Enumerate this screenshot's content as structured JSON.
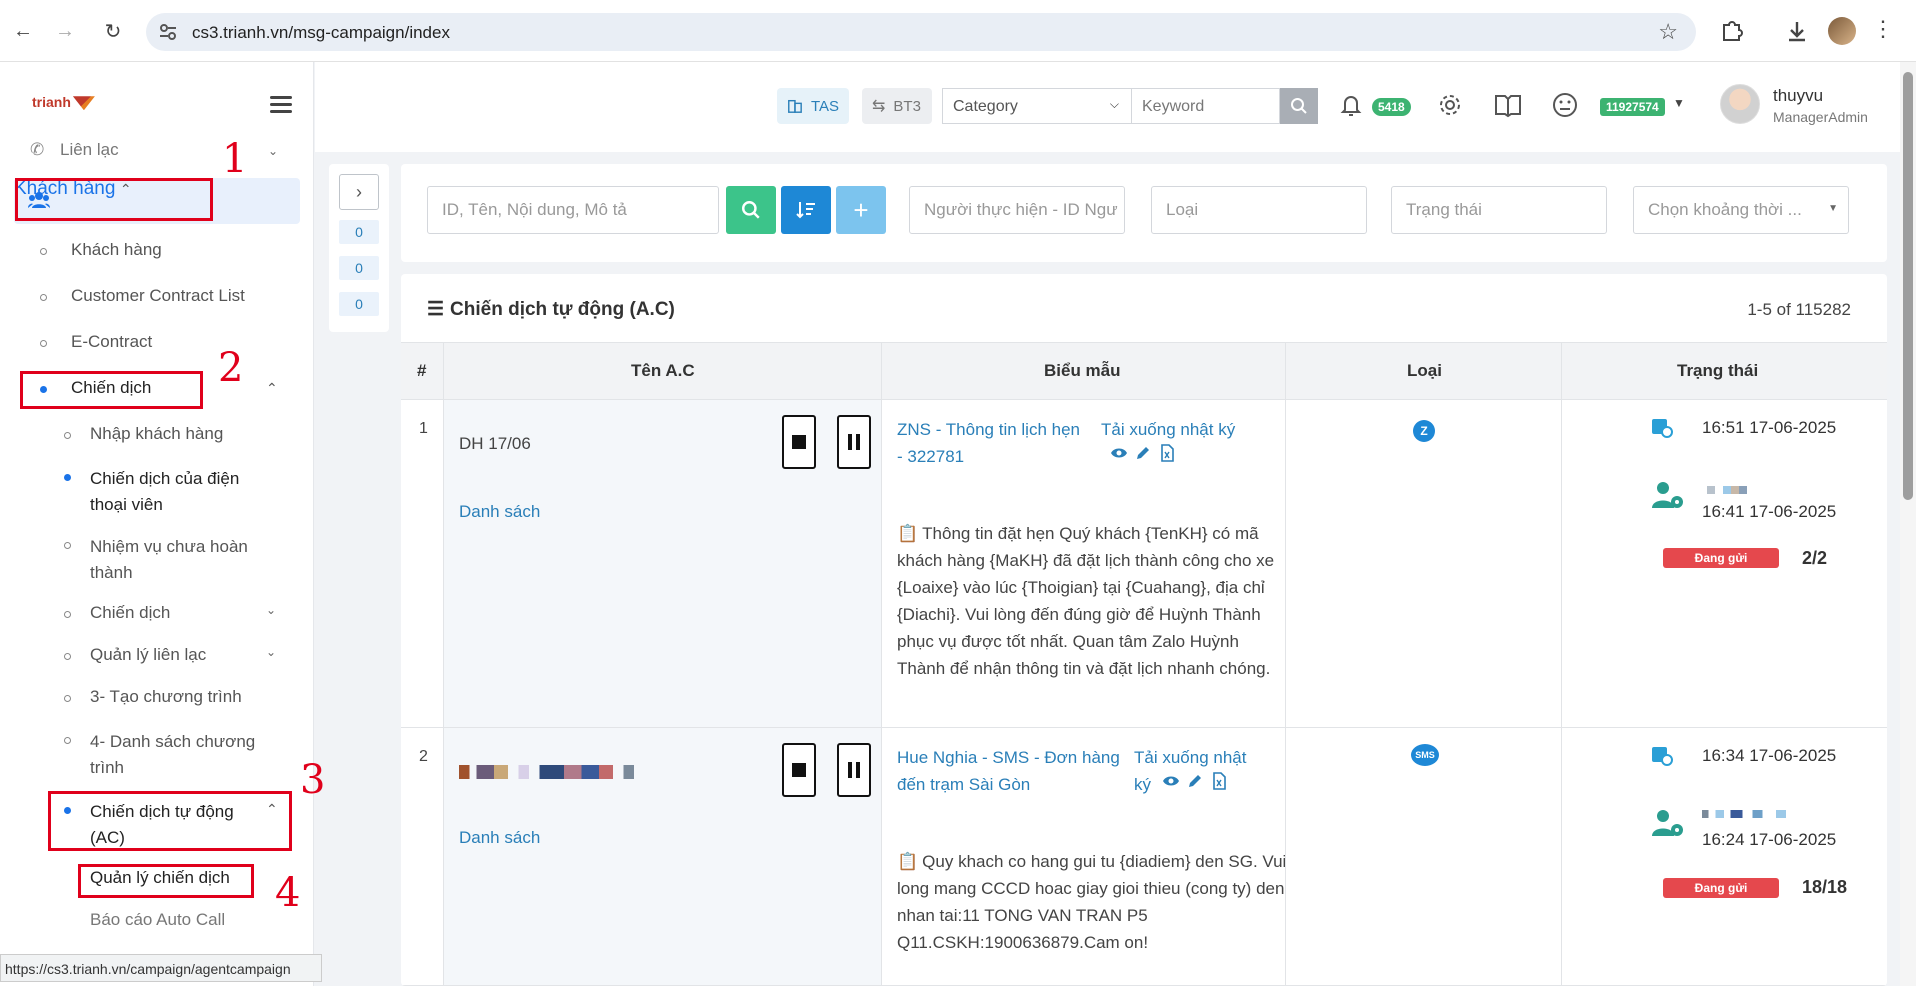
{
  "browser": {
    "url": "cs3.trianh.vn/msg-campaign/index",
    "status_url": "https://cs3.trianh.vn/campaign/agentcampaign"
  },
  "logo": {
    "text": "trianh"
  },
  "sidebar": {
    "lien_lac": "Liên lạc",
    "khach_hang_group": "Khách hàng",
    "items": [
      "Khách hàng",
      "Customer Contract List",
      "E-Contract"
    ],
    "chien_dich_group": "Chiến dịch",
    "sub_items": [
      "Nhập khách hàng",
      "Chiến dịch của điện thoại viên",
      "Nhiệm vụ chưa hoàn thành",
      "Chiến dịch",
      "Quản lý liên lạc",
      "3- Tạo chương trình",
      "4- Danh sách chương trình",
      "Chiến dịch tự động (AC)",
      "Quản lý chiến dịch",
      "Báo cáo Auto Call"
    ]
  },
  "annotations": [
    "1",
    "2",
    "3",
    "4"
  ],
  "topbar": {
    "tas": "TAS",
    "bt3": "BT3",
    "category_placeholder": "Category",
    "keyword_placeholder": "Keyword",
    "notif_count": "5418",
    "balance": "11927574",
    "user_name": "thuyvu",
    "user_role": "ManagerAdmin"
  },
  "mini_counts": [
    "0",
    "0",
    "0"
  ],
  "filters": {
    "search_placeholder": "ID, Tên, Nội dung, Mô tả",
    "agent_placeholder": "Người thực hiện - ID Ngư",
    "type_placeholder": "Loại",
    "status_placeholder": "Trạng thái",
    "time_placeholder": "Chọn khoảng thời ..."
  },
  "table": {
    "title": "Chiến dịch tự động (A.C)",
    "count": "1-5 of 115282",
    "headers": [
      "#",
      "Tên A.C",
      "Biểu mẫu",
      "Loại",
      "Trạng thái"
    ],
    "rows": [
      {
        "num": "1",
        "name": "DH 17/06",
        "list_link": "Danh sách",
        "template_line1": "ZNS - Thông tin lịch hẹn",
        "template_line2": "- 322781",
        "download": "Tải xuống nhật ký",
        "content": "Thông tin đặt hẹn Quý khách {TenKH} có mã khách hàng {MaKH} đã đặt lịch thành công cho xe {Loaixe} vào lúc {Thoigian} tại {Cuahang}, địa chỉ {Diachi}. Vui lòng đến đúng giờ để Huỳnh Thành phục vụ được tốt nhất. Quan tâm Zalo Huỳnh Thành để nhận thông tin và đặt lịch nhanh chóng.",
        "type_icon": "zalo-icon",
        "scheduled": "16:51 17-06-2025",
        "created": "16:41 17-06-2025",
        "status": "Đang gửi",
        "ratio": "2/2"
      },
      {
        "num": "2",
        "name": "",
        "list_link": "Danh sách",
        "template_line1": "Hue Nghia - SMS - Đơn hàng",
        "template_line2": "đến trạm Sài Gòn",
        "download_line1": "Tải xuống nhật",
        "download_line2": "ký",
        "content": "Quy khach co hang gui tu {diadiem} den SG. Vui long mang CCCD hoac giay gioi thieu (cong ty) den nhan tai:11 TONG VAN TRAN P5 Q11.CSKH:1900636879.Cam on!",
        "type_icon": "sms-icon",
        "scheduled": "16:34 17-06-2025",
        "created": "16:24 17-06-2025",
        "status": "Đang gửi",
        "ratio": "18/18"
      }
    ]
  },
  "colors": {
    "accent": "#1a73e8",
    "annotation": "#e0001b",
    "status_red": "#e5484d",
    "green": "#3cb371"
  }
}
